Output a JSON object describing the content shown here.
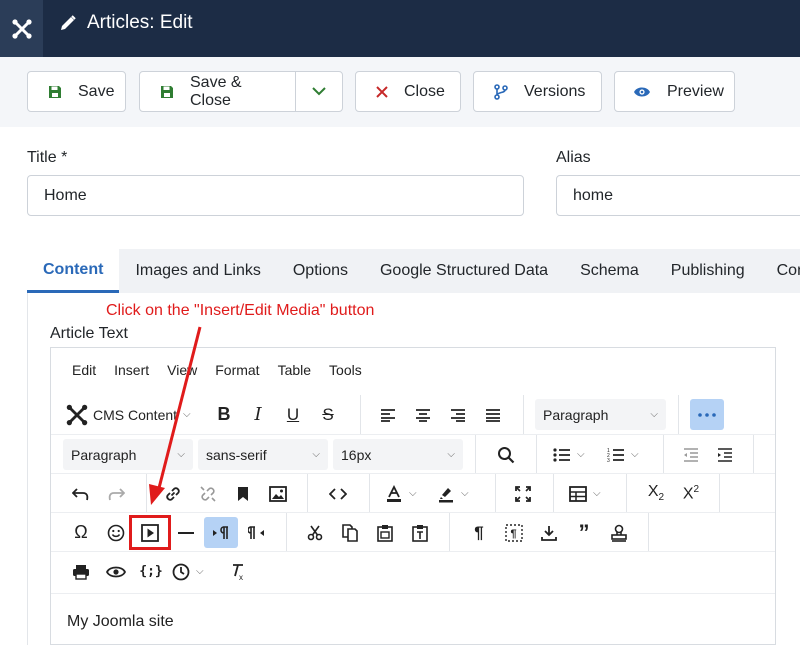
{
  "header": {
    "title": "Articles: Edit"
  },
  "toolbar": {
    "save": "Save",
    "save_close": "Save & Close",
    "close": "Close",
    "versions": "Versions",
    "preview": "Preview"
  },
  "fields": {
    "title_label": "Title *",
    "title_value": "Home",
    "alias_label": "Alias",
    "alias_value": "home"
  },
  "tabs": [
    {
      "label": "Content"
    },
    {
      "label": "Images and Links"
    },
    {
      "label": "Options"
    },
    {
      "label": "Google Structured Data"
    },
    {
      "label": "Schema"
    },
    {
      "label": "Publishing"
    },
    {
      "label": "Conf"
    }
  ],
  "annotation": "Click on the \"Insert/Edit Media\" button",
  "article_text_label": "Article Text",
  "editor": {
    "menus": [
      "Edit",
      "Insert",
      "View",
      "Format",
      "Table",
      "Tools"
    ],
    "cms_content": "CMS Content",
    "block_format": "Paragraph",
    "paragraph_select": "Paragraph",
    "font_family": "sans-serif",
    "font_size": "16px",
    "content": "My Joomla site"
  },
  "colors": {
    "header_bg": "#1c2c45",
    "accent": "#2a69b8",
    "save_icon": "#2f7d32",
    "close_icon": "#c62828",
    "annotation": "#e01b1b"
  }
}
